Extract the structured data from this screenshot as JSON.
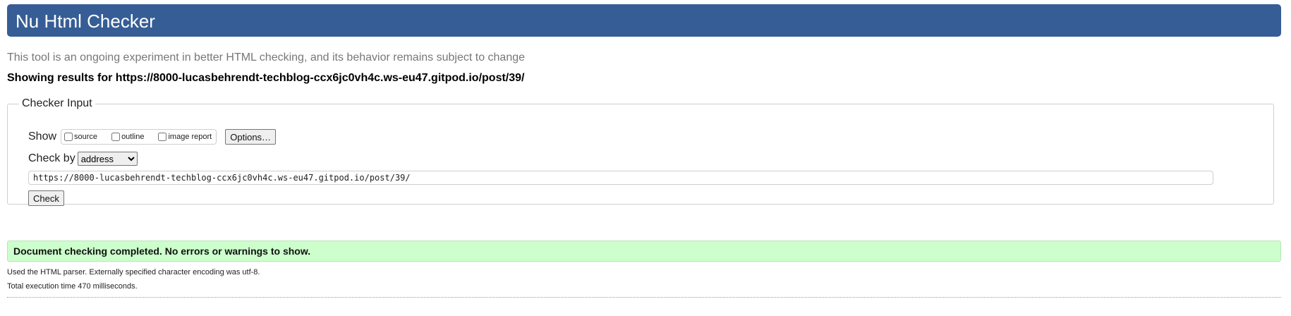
{
  "app": {
    "title": "Nu Html Checker",
    "tagline": "This tool is an ongoing experiment in better HTML checking, and its behavior remains subject to change",
    "results_line": "Showing results for https://8000-lucasbehrendt-techblog-ccx6jc0vh4c.ws-eu47.gitpod.io/post/39/"
  },
  "checker_input": {
    "legend": "Checker Input",
    "show_label": "Show",
    "show_options": [
      {
        "label": "source",
        "checked": false
      },
      {
        "label": "outline",
        "checked": false
      },
      {
        "label": "image report",
        "checked": false
      }
    ],
    "options_button": "Options…",
    "check_by_label": "Check by",
    "check_by_value": "address",
    "url_value": "https://8000-lucasbehrendt-techblog-ccx6jc0vh4c.ws-eu47.gitpod.io/post/39/",
    "check_button": "Check"
  },
  "results": {
    "success_message": "Document checking completed. No errors or warnings to show.",
    "parser_note": "Used the HTML parser. Externally specified character encoding was utf-8.",
    "execution_time": "Total execution time 470 milliseconds."
  },
  "colors": {
    "header_bg": "#365d95",
    "success_bg": "#ccffcc"
  }
}
